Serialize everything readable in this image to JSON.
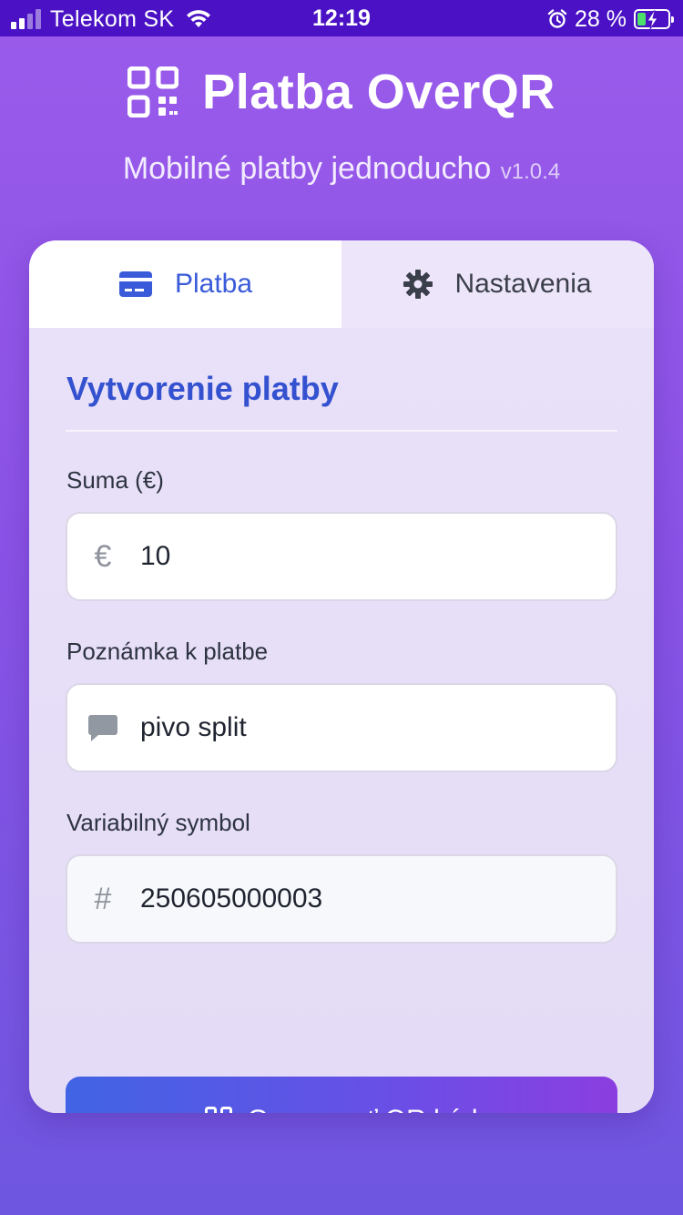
{
  "status_bar": {
    "carrier": "Telekom SK",
    "time": "12:19",
    "battery_percent": "28 %",
    "battery_level": 0.28,
    "charging": true
  },
  "header": {
    "title": "Platba OverQR",
    "subtitle": "Mobilné platby jednoducho",
    "version": "v1.0.4",
    "logo_icon": "qr-code-icon"
  },
  "tabs": [
    {
      "label": "Platba",
      "icon": "credit-card-icon",
      "active": true
    },
    {
      "label": "Nastavenia",
      "icon": "gear-icon",
      "active": false
    }
  ],
  "form": {
    "title": "Vytvorenie platby",
    "amount": {
      "label": "Suma (€)",
      "icon": "€",
      "value": "10"
    },
    "note": {
      "label": "Poznámka k platbe",
      "icon": "comment-icon",
      "value": "pivo split"
    },
    "variable_symbol": {
      "label": "Variabilný symbol",
      "icon": "#",
      "value": "250605000003"
    },
    "submit_label": "Generovať QR kód"
  },
  "colors": {
    "accent": "#3a5bd9",
    "title_blue": "#3452cf",
    "status_bar": "#4a12c4",
    "battery_green": "#4ae06a"
  }
}
